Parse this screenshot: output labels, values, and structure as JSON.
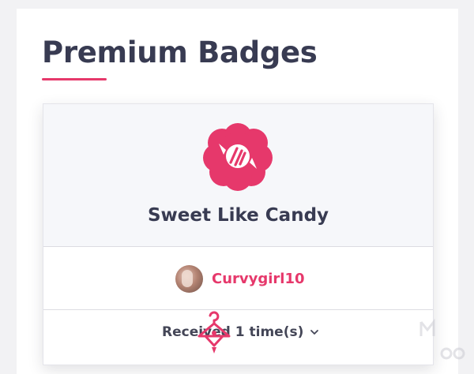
{
  "section": {
    "title": "Premium Badges"
  },
  "badge": {
    "icon": "candy-flower-icon",
    "name": "Sweet Like Candy"
  },
  "owner": {
    "avatar": "user-avatar",
    "username": "Curvygirl10"
  },
  "received": {
    "label": "Received 1 time(s)",
    "expand_icon": "chevron-down-icon"
  },
  "overlay": {
    "icon": "hanger-icon"
  },
  "colors": {
    "accent": "#e6386b",
    "title": "#383b52",
    "background": "#f2f2f4"
  }
}
